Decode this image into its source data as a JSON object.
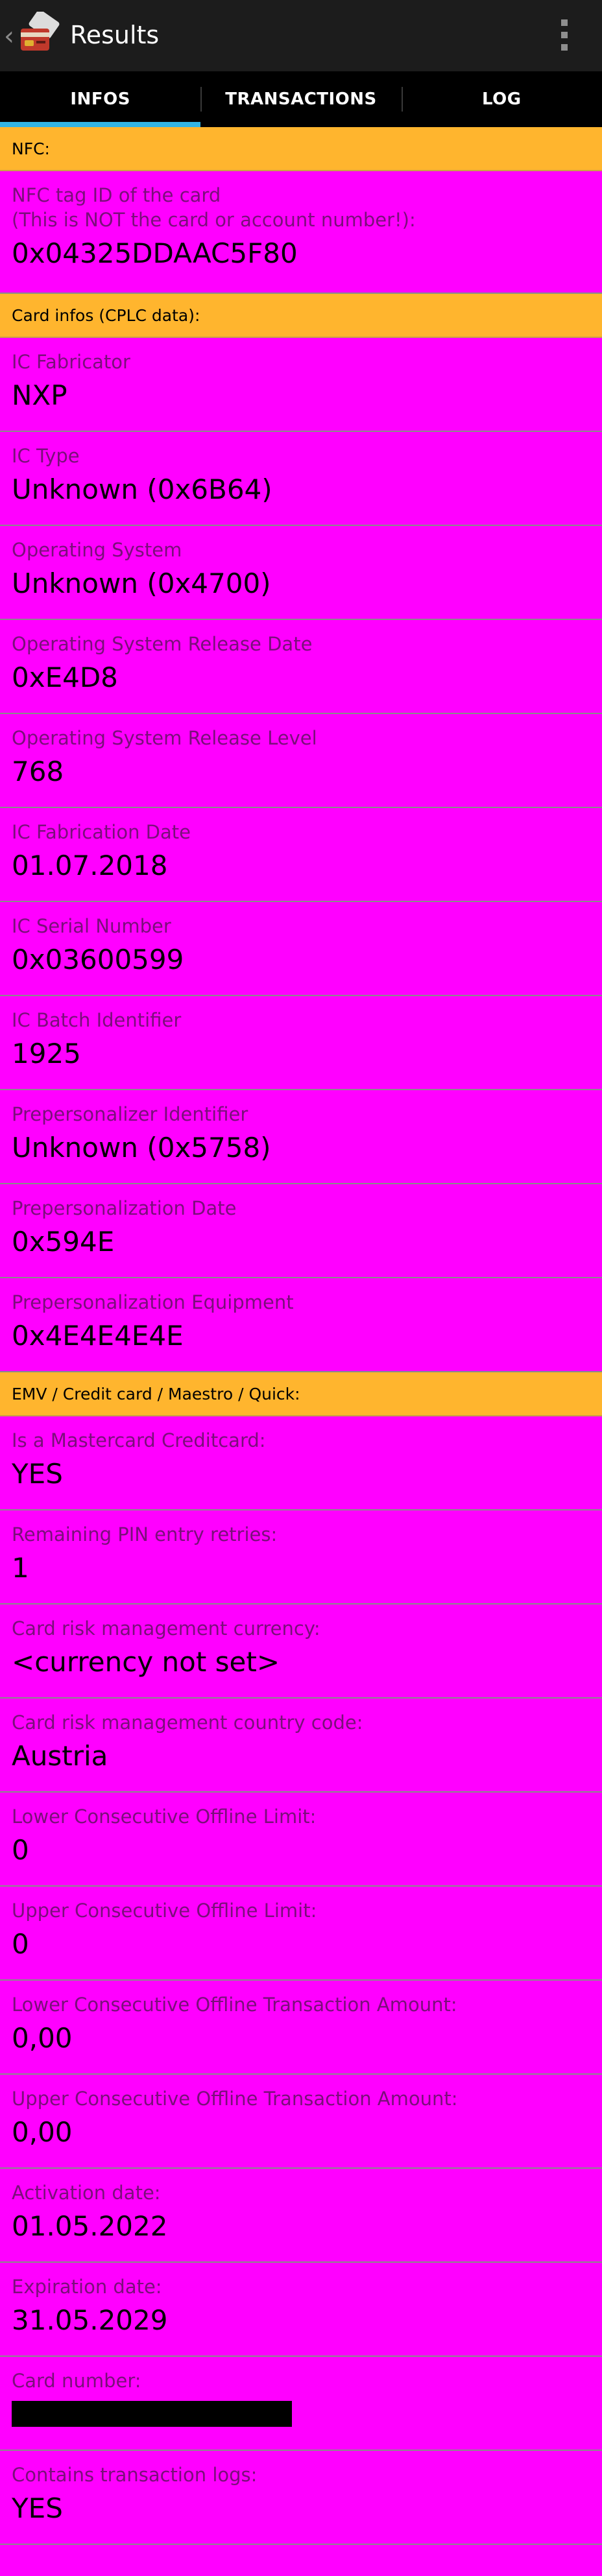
{
  "actionbar": {
    "title": "Results"
  },
  "tabs": [
    {
      "label": "INFOS",
      "active": true
    },
    {
      "label": "TRANSACTIONS",
      "active": false
    },
    {
      "label": "LOG",
      "active": false
    }
  ],
  "nfc": {
    "header": "NFC:",
    "items": [
      {
        "label": "NFC tag ID of the card\n(This is NOT the card or account number!):",
        "value": "0x04325DDAAC5F80"
      }
    ]
  },
  "cplc": {
    "header": "Card infos (CPLC data):",
    "items": [
      {
        "label": "IC Fabricator",
        "value": "NXP"
      },
      {
        "label": "IC Type",
        "value": "Unknown (0x6B64)"
      },
      {
        "label": "Operating System",
        "value": "Unknown (0x4700)"
      },
      {
        "label": "Operating System Release Date",
        "value": "0xE4D8"
      },
      {
        "label": "Operating System Release Level",
        "value": "768"
      },
      {
        "label": "IC Fabrication Date",
        "value": "01.07.2018"
      },
      {
        "label": "IC Serial Number",
        "value": "0x03600599"
      },
      {
        "label": "IC Batch Identifier",
        "value": "1925"
      },
      {
        "label": "Prepersonalizer Identifier",
        "value": "Unknown (0x5758)"
      },
      {
        "label": "Prepersonalization Date",
        "value": "0x594E"
      },
      {
        "label": "Prepersonalization Equipment",
        "value": "0x4E4E4E4E"
      }
    ]
  },
  "emv": {
    "header": "EMV / Credit card / Maestro / Quick:",
    "items": [
      {
        "label": "Is a Mastercard Creditcard:",
        "value": "YES"
      },
      {
        "label": "Remaining PIN entry retries:",
        "value": "1"
      },
      {
        "label": "Card risk management currency:",
        "value": "<currency not set>"
      },
      {
        "label": "Card risk management country code:",
        "value": "Austria"
      },
      {
        "label": "Lower Consecutive Offline Limit:",
        "value": "0"
      },
      {
        "label": "Upper Consecutive Offline Limit:",
        "value": "0"
      },
      {
        "label": "Lower Consecutive Offline Transaction Amount:",
        "value": "0,00"
      },
      {
        "label": "Upper Consecutive Offline Transaction Amount:",
        "value": "0,00"
      },
      {
        "label": "Activation date:",
        "value": "01.05.2022"
      },
      {
        "label": "Expiration date:",
        "value": "31.05.2029"
      },
      {
        "label": "Card number:",
        "value": ""
      },
      {
        "label": "Contains transaction logs:",
        "value": "YES"
      }
    ]
  },
  "colors": {
    "background": "#FF00FF",
    "section_header": "#FFB52E",
    "tab_indicator": "#33B5E5",
    "actionbar": "#1C1C1C"
  },
  "icons": [
    "back-chevron-icon",
    "app-card-icon",
    "overflow-menu-icon"
  ]
}
